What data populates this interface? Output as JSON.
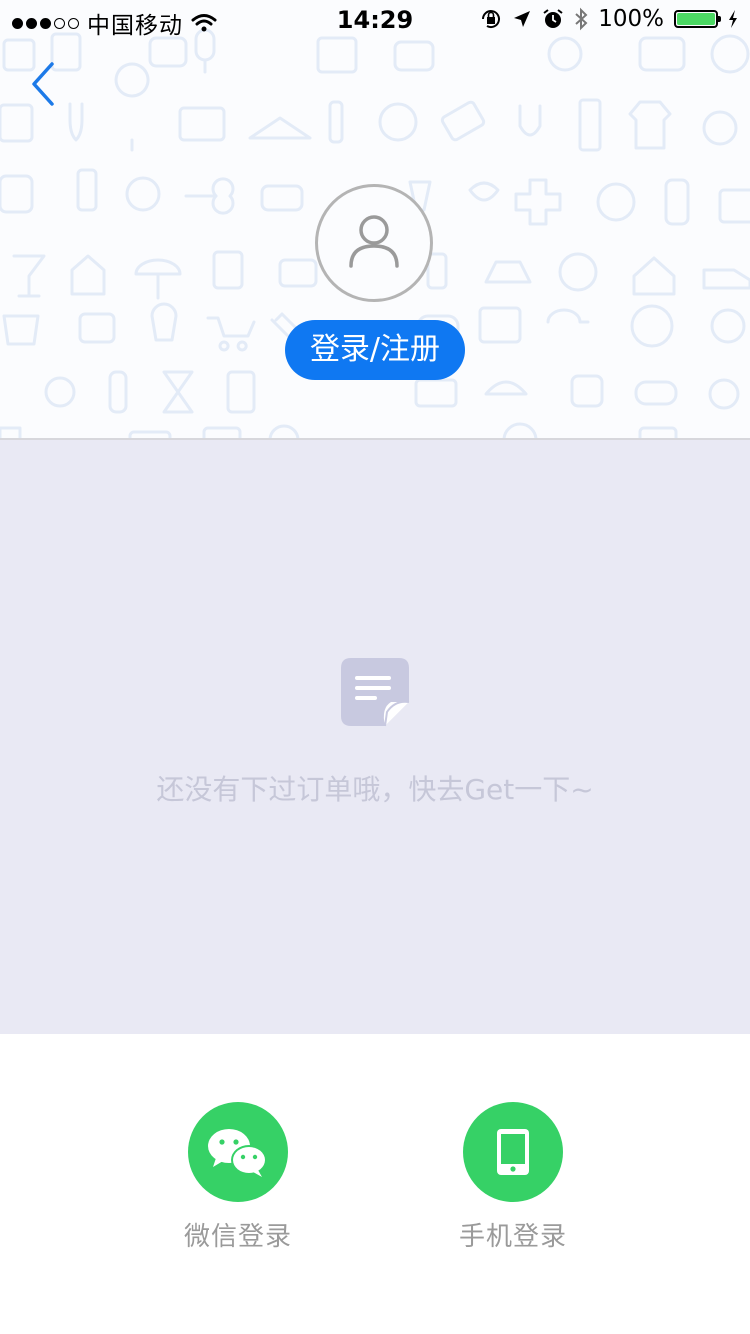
{
  "status_bar": {
    "carrier": "中国移动",
    "time": "14:29",
    "battery": "100%"
  },
  "header": {
    "login_label": "登录/注册"
  },
  "empty_state": {
    "message": "还没有下过订单哦，快去Get一下~"
  },
  "login_options": {
    "wechat_label": "微信登录",
    "phone_label": "手机登录"
  },
  "colors": {
    "accent": "#0f78f2",
    "green": "#36d166",
    "empty_bg": "#e9e9f4"
  }
}
